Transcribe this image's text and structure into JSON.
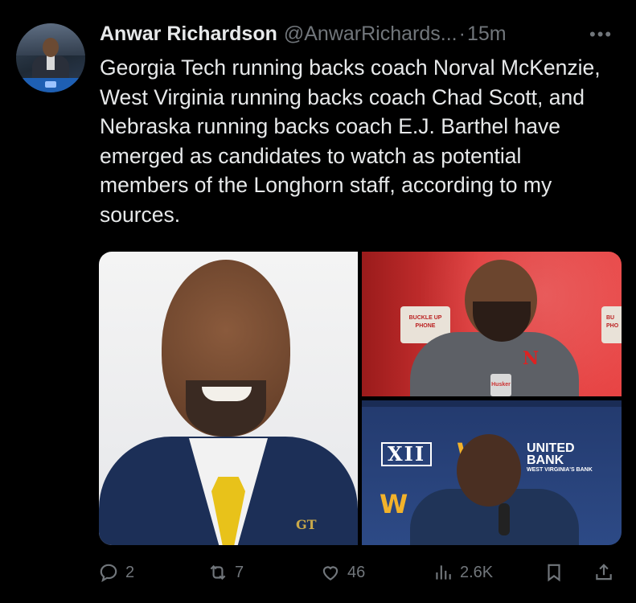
{
  "author": {
    "name": "Anwar Richardson",
    "handle": "@AnwarRichards...",
    "separator": "·",
    "time": "15m"
  },
  "more_label": "•••",
  "tweet_text": "Georgia Tech running backs coach Norval McKenzie, West Virginia running backs coach Chad Scott, and Nebraska running backs coach E.J. Barthel have emerged as candidates to watch as potential members of the Longhorn staff, according to my sources.",
  "media": {
    "left_pin": "GT",
    "top_right": {
      "badge_left": "BUCKLE UP\nPHONE",
      "badge_right": "BU\nPHO",
      "mic_label": "Husker"
    },
    "bottom_right": {
      "conference_logo": "XII",
      "bank_name_1": "UNITED",
      "bank_name_2": "BANK",
      "bank_sub": "WEST VIRGINIA'S BANK"
    }
  },
  "actions": {
    "replies": "2",
    "reposts": "7",
    "likes": "46",
    "views": "2.6K"
  }
}
